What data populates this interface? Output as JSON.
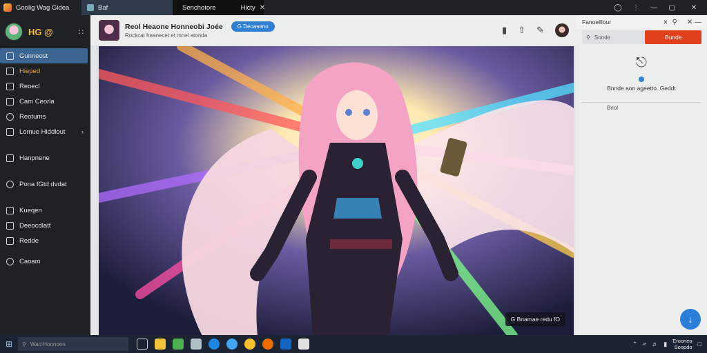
{
  "titlebar": {
    "app_title": "Goolig Wag Gidea",
    "tab1_label": "Baf",
    "tab2_label": "Senchotore",
    "tab2_extra": "Hicty",
    "tab2_close": "✕"
  },
  "sidebar": {
    "brand": "HG @",
    "grid_icon": "grid-icon",
    "items": [
      {
        "label": "Gunneost",
        "icon": "home-icon"
      },
      {
        "label": "Hieped",
        "icon": "flame-icon"
      },
      {
        "label": "Reoecl",
        "icon": "bookmark-icon"
      },
      {
        "label": "Cam Ceorla",
        "icon": "calendar-icon"
      },
      {
        "label": "Reoturns",
        "icon": "compass-icon"
      },
      {
        "label": "Lomue Hiddlout",
        "icon": "layers-icon"
      },
      {
        "label": "Hanpnene",
        "icon": "image-icon"
      },
      {
        "label": "Pona fGtd dvdat",
        "icon": "chat-icon"
      },
      {
        "label": "Kueqen",
        "icon": "book-icon"
      },
      {
        "label": "Deeocdlatt",
        "icon": "edit-icon"
      },
      {
        "label": "Redde",
        "icon": "list-icon"
      },
      {
        "label": "Caoam",
        "icon": "settings-icon"
      }
    ]
  },
  "post": {
    "title": "Reol Heaone Honneobi Joée",
    "subtitle": "Rockcat heanecet et mnel atonda",
    "badge": "G Deoaseno",
    "caption": "G Bnamae redu fO"
  },
  "rpanel": {
    "top_label": "Fanoelllour",
    "top_close": "✕",
    "top_extra": "✕ —",
    "search_placeholder": "Sonde",
    "red_button": "Bunde",
    "empty_msg": "Bnnde aon ageetto. Geddt",
    "send_label": "Bnol"
  },
  "taskbar": {
    "search_text": "Wad Hoonoen",
    "clock_line1": "Erooneo",
    "clock_line2": "Soopdo"
  }
}
